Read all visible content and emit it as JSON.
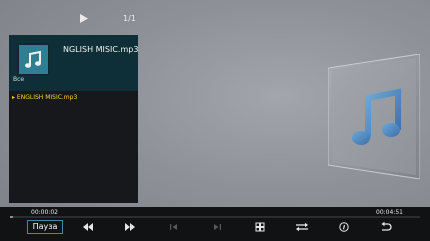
{
  "header": {
    "page_count": "1/1"
  },
  "panel": {
    "track_title": "NGLISH MISIC.mp3",
    "folder_label": "Все",
    "playlist": [
      {
        "label": "▸ ENGLISH MISIC.mp3",
        "state": "playing"
      }
    ]
  },
  "playback": {
    "current_time": "00:00:02",
    "total_time": "00:04:51",
    "progress_fraction": 0.007
  },
  "controls": {
    "pause_label": "Пауза",
    "icons": [
      "rewind-icon",
      "fast-forward-icon",
      "previous-track-icon",
      "next-track-icon",
      "grid-icon",
      "repeat-icon",
      "info-icon",
      "back-icon"
    ]
  },
  "colors": {
    "accent_border": "#3a8fa6",
    "playing_item": "#ffd23a",
    "thumb": "#2f7f93"
  }
}
